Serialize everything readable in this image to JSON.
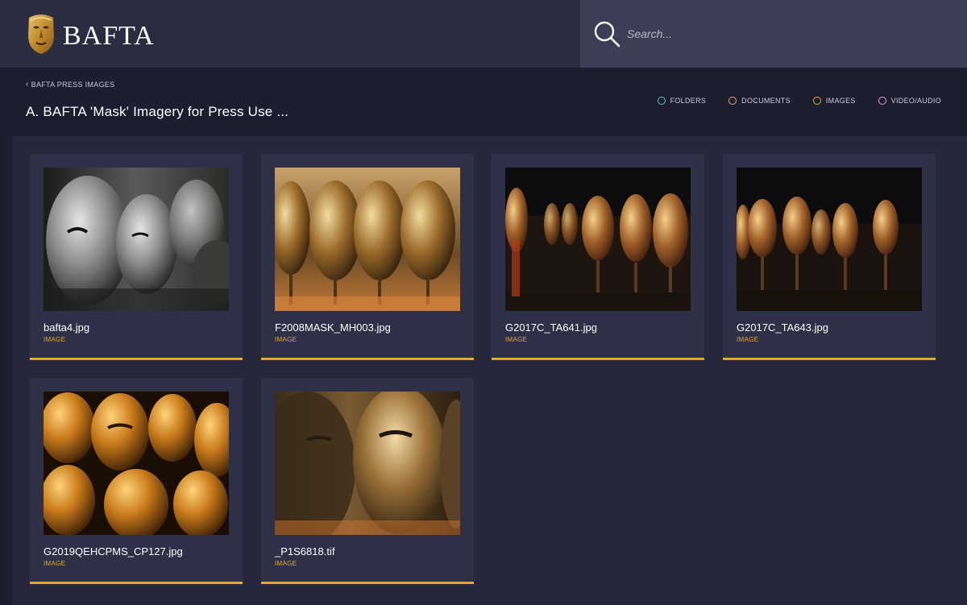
{
  "header": {
    "logo_text": "BAFTA",
    "search_placeholder": "Search..."
  },
  "breadcrumb": {
    "label": "BAFTA PRESS IMAGES"
  },
  "page": {
    "title": "A. BAFTA 'Mask' Imagery for Press Use ..."
  },
  "filters": [
    {
      "label": "FOLDERS",
      "color": "#5cc9a7"
    },
    {
      "label": "DOCUMENTS",
      "color": "#e8a57d"
    },
    {
      "label": "IMAGES",
      "color": "#e6a82b"
    },
    {
      "label": "VIDEO/AUDIO",
      "color": "#d9a3d6"
    }
  ],
  "accent_color": "#e6a82b",
  "files": [
    {
      "name": "bafta4.jpg",
      "type": "IMAGE"
    },
    {
      "name": "F2008MASK_MH003.jpg",
      "type": "IMAGE"
    },
    {
      "name": "G2017C_TA641.jpg",
      "type": "IMAGE"
    },
    {
      "name": "G2017C_TA643.jpg",
      "type": "IMAGE"
    },
    {
      "name": "G2019QEHCPMS_CP127.jpg",
      "type": "IMAGE"
    },
    {
      "name": "_P1S6818.tif",
      "type": "IMAGE"
    }
  ]
}
